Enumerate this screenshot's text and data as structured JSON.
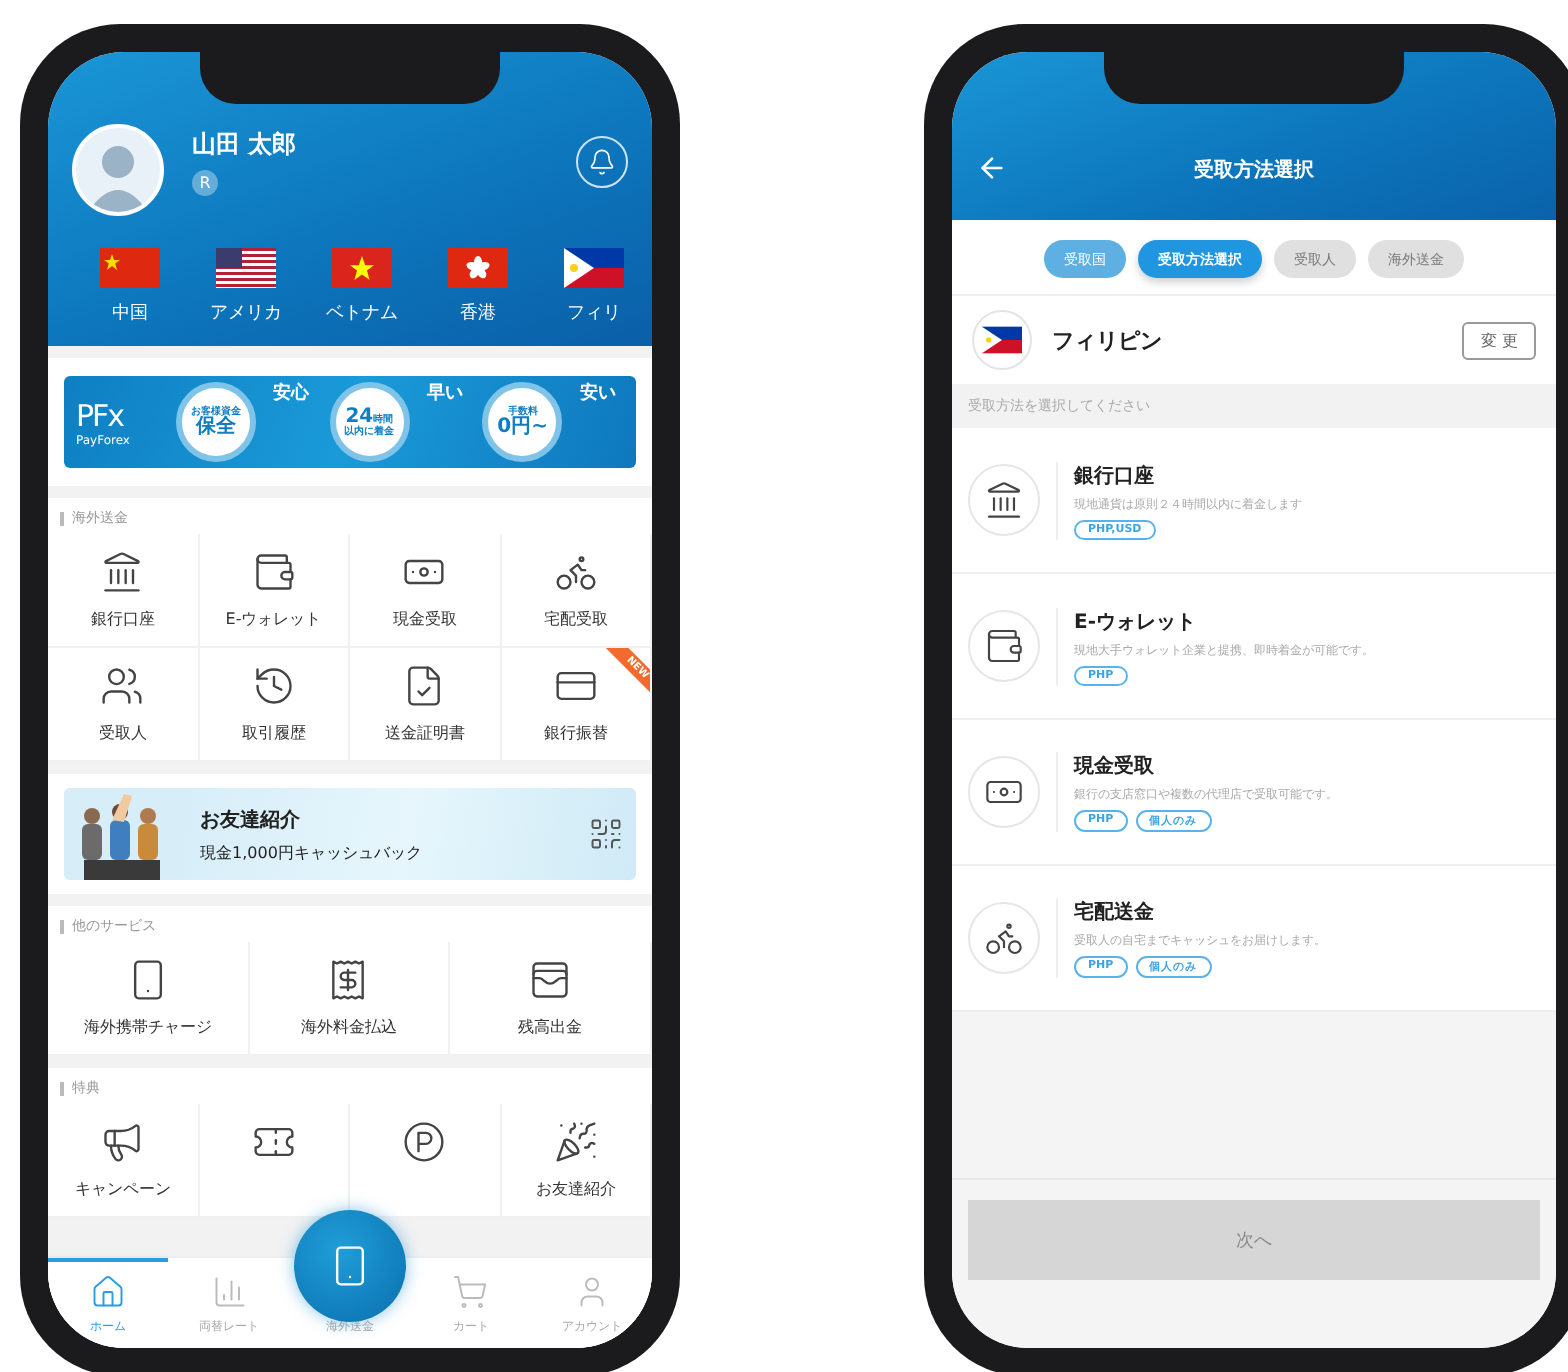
{
  "home_screen": {
    "profile": {
      "name": "山田 太郎",
      "rank": "R"
    },
    "countries": [
      {
        "label": "中国",
        "kind": "cn"
      },
      {
        "label": "アメリカ",
        "kind": "us"
      },
      {
        "label": "ベトナム",
        "kind": "vn"
      },
      {
        "label": "香港",
        "kind": "hk"
      },
      {
        "label": "フィリ",
        "kind": "ph"
      }
    ],
    "promo_banner": {
      "logo": "PFx",
      "brand": "PayForex",
      "points": [
        {
          "heading": "安心",
          "top": "お客様資金",
          "main": "保全"
        },
        {
          "heading": "早い",
          "main": "24",
          "unit": "時間",
          "bottom": "以内に着金"
        },
        {
          "heading": "安い",
          "top": "手数料",
          "main": "0円~"
        }
      ]
    },
    "remittance": {
      "title": "海外送金",
      "items": [
        {
          "label": "銀行口座"
        },
        {
          "label": "E-ウォレット"
        },
        {
          "label": "現金受取"
        },
        {
          "label": "宅配受取"
        },
        {
          "label": "受取人"
        },
        {
          "label": "取引履歴"
        },
        {
          "label": "送金証明書"
        },
        {
          "label": "銀行振替",
          "badge": "NEW"
        }
      ]
    },
    "referral_banner": {
      "title": "お友達紹介",
      "text": "現金1,000円キャッシュバック"
    },
    "other_services": {
      "title": "他のサービス",
      "items": [
        {
          "label": "海外携帯チャージ"
        },
        {
          "label": "海外料金払込"
        },
        {
          "label": "残高出金"
        }
      ]
    },
    "perks": {
      "title": "特典",
      "items": [
        {
          "kind": "labeled",
          "label": "キャンペーン"
        },
        {
          "kind": "icon_only"
        },
        {
          "kind": "icon_only"
        },
        {
          "kind": "labeled",
          "label": "お友達紹介"
        }
      ]
    },
    "tab_bar": [
      {
        "kind": "tab",
        "label": "ホーム",
        "selected": true
      },
      {
        "kind": "tab",
        "label": "両替レート",
        "selected": false
      },
      {
        "kind": "center",
        "label": "海外送金",
        "selected": false
      },
      {
        "kind": "tab",
        "label": "カート",
        "selected": false
      },
      {
        "kind": "tab",
        "label": "アカウント",
        "selected": false
      }
    ]
  },
  "method_screen": {
    "title": "受取方法選択",
    "steps": [
      {
        "label": "受取国",
        "selected": false,
        "completed": true
      },
      {
        "label": "受取方法選択",
        "selected": true,
        "completed": false
      },
      {
        "label": "受取人",
        "selected": false,
        "completed": false
      },
      {
        "label": "海外送金",
        "selected": false,
        "completed": false
      }
    ],
    "country": {
      "name": "フィリピン",
      "kind": "ph",
      "action": "変 更"
    },
    "instruction": "受取方法を選択してください",
    "methods": [
      {
        "title": "銀行口座",
        "description": "現地通貨は原則２４時間以内に着金します",
        "tags": [
          "PHP,USD"
        ]
      },
      {
        "title": "E-ウォレット",
        "description": "現地大手ウォレット企業と提携、即時着金が可能です。",
        "tags": [
          "PHP"
        ]
      },
      {
        "title": "現金受取",
        "description": "銀行の支店窓口や複数の代理店で受取可能です。",
        "tags": [
          "PHP",
          "個人のみ"
        ]
      },
      {
        "title": "宅配送金",
        "description": "受取人の自宅までキャッシュをお届けします。",
        "tags": [
          "PHP",
          "個人のみ"
        ]
      }
    ],
    "next_button": {
      "label": "次へ",
      "disabled": true
    }
  }
}
